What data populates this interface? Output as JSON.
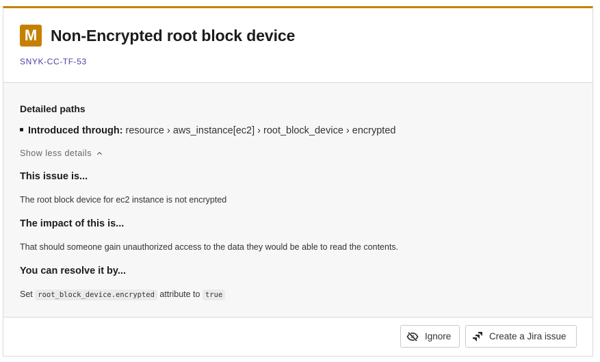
{
  "issue": {
    "severity": "M",
    "title": "Non-Encrypted root block device",
    "id": "SNYK-CC-TF-53"
  },
  "details": {
    "detailed_paths_heading": "Detailed paths",
    "introduced_label": "Introduced through:",
    "path": "resource › aws_instance[ec2] › root_block_device › encrypted",
    "toggle_label": "Show less details"
  },
  "sections": {
    "issue_heading": "This issue is...",
    "issue_text": "The root block device for ec2 instance is not encrypted",
    "impact_heading": "The impact of this is...",
    "impact_text": "That should someone gain unauthorized access to the data they would be able to read the contents.",
    "resolve_heading": "You can resolve it by...",
    "resolve_prefix": "Set",
    "resolve_code": "root_block_device.encrypted",
    "resolve_middle": "attribute to",
    "resolve_value": "true"
  },
  "actions": {
    "ignore_label": "Ignore",
    "jira_label": "Create a Jira issue"
  },
  "colors": {
    "severity_medium": "#c68000",
    "issue_id": "#4b3fa6"
  },
  "icons": {
    "ignore": "eye-slash-icon",
    "jira": "jira-icon",
    "toggle": "chevron-up-icon"
  }
}
